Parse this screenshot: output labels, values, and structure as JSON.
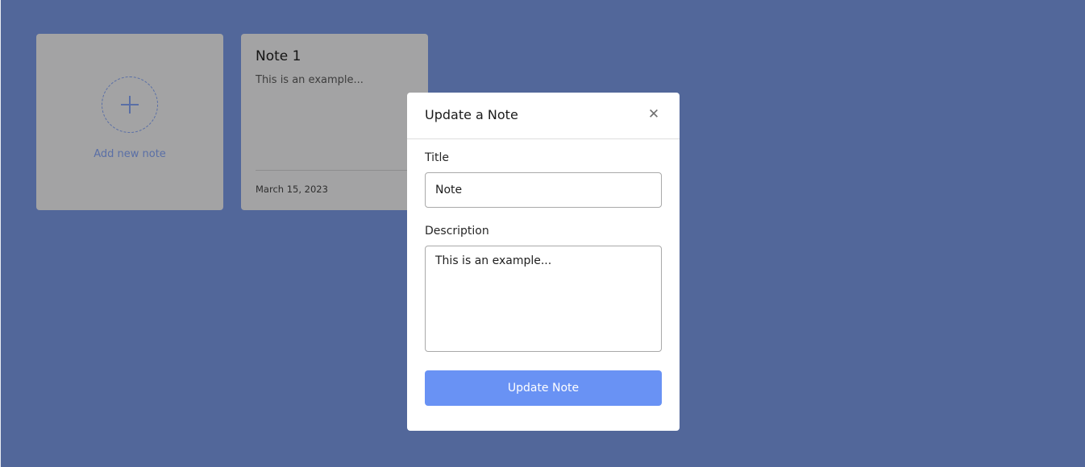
{
  "cards": {
    "add": {
      "label": "Add new note",
      "icon": "plus-icon"
    },
    "note": {
      "title": "Note 1",
      "description": "This is an example...",
      "date": "March 15, 2023",
      "menu_icon": "more-icon",
      "menu_glyph": "⋮"
    }
  },
  "modal": {
    "title": "Update a Note",
    "close_glyph": "✕",
    "title_label": "Title",
    "title_value": "Note",
    "description_label": "Description",
    "description_value": "This is an example...",
    "submit_label": "Update Note"
  },
  "colors": {
    "background": "#52679a",
    "accent": "#6992f4",
    "card": "#a3a3a4"
  }
}
